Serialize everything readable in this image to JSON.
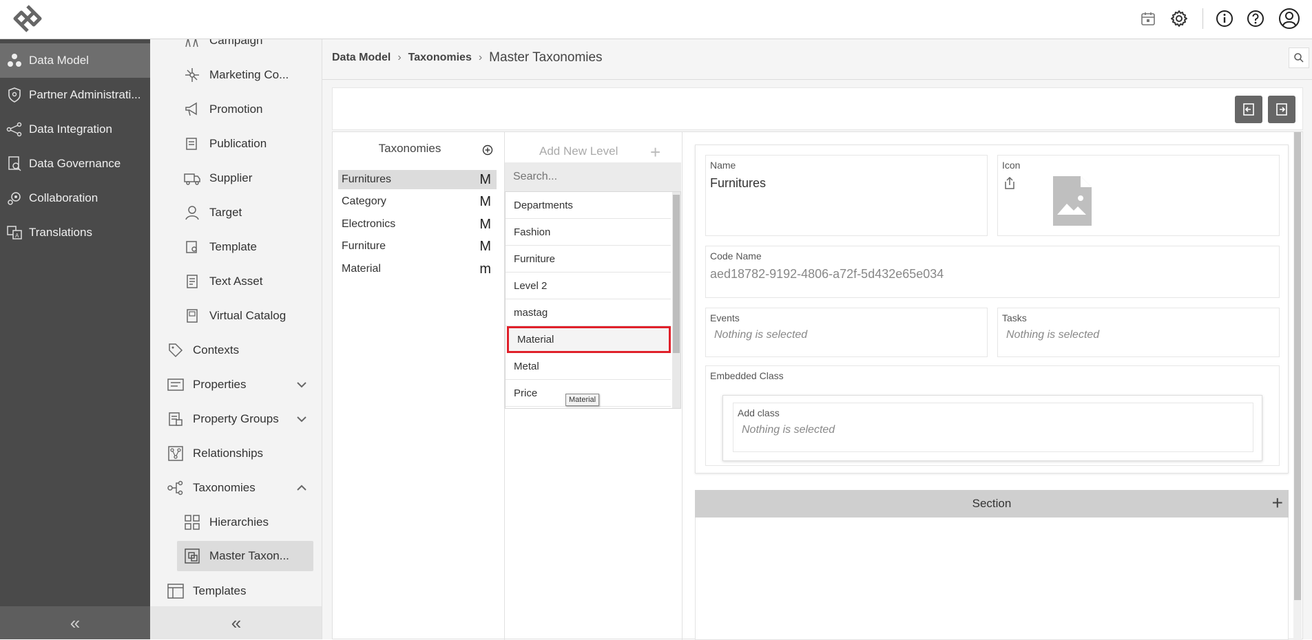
{
  "topbar": {
    "icons": [
      "calendar-icon",
      "gear-icon",
      "info-icon",
      "help-icon",
      "user-icon"
    ]
  },
  "leftnav": {
    "items": [
      {
        "label": "Data Model",
        "icon": "data-model-icon",
        "active": true
      },
      {
        "label": "Partner Administrati...",
        "icon": "shield-icon"
      },
      {
        "label": "Data Integration",
        "icon": "share-icon"
      },
      {
        "label": "Data Governance",
        "icon": "governance-icon"
      },
      {
        "label": "Collaboration",
        "icon": "collaboration-icon"
      },
      {
        "label": "Translations",
        "icon": "translate-icon"
      }
    ],
    "collapse": "«"
  },
  "subnav": {
    "items": [
      {
        "label": "Campaign"
      },
      {
        "label": "Marketing Co..."
      },
      {
        "label": "Promotion"
      },
      {
        "label": "Publication"
      },
      {
        "label": "Supplier"
      },
      {
        "label": "Target"
      },
      {
        "label": "Template"
      },
      {
        "label": "Text Asset"
      },
      {
        "label": "Virtual Catalog"
      },
      {
        "label": "Contexts"
      },
      {
        "label": "Properties"
      },
      {
        "label": "Property Groups"
      },
      {
        "label": "Relationships"
      },
      {
        "label": "Taxonomies"
      },
      {
        "label": "Hierarchies"
      },
      {
        "label": "Master Taxon..."
      },
      {
        "label": "Templates"
      }
    ],
    "collapse": "«"
  },
  "breadcrumb": {
    "items": [
      "Data Model",
      "Taxonomies"
    ],
    "current": "Master Taxonomies",
    "sep": "›"
  },
  "taxonomies": {
    "title": "Taxonomies",
    "items": [
      {
        "label": "Furnitures",
        "mark": "M",
        "selected": true
      },
      {
        "label": "Category",
        "mark": "M"
      },
      {
        "label": "Electronics",
        "mark": "M"
      },
      {
        "label": "Furniture",
        "mark": "M"
      },
      {
        "label": "Material",
        "mark": "m"
      }
    ]
  },
  "levels": {
    "add_label": "Add New Level",
    "plus": "+",
    "search_placeholder": "Search...",
    "items": [
      "Departments",
      "Fashion",
      "Furniture",
      "Level 2",
      "mastag",
      "Material",
      "Metal",
      "Price"
    ],
    "highlighted": "Material",
    "tooltip": "Material"
  },
  "detail": {
    "name_label": "Name",
    "name_value": "Furnitures",
    "icon_label": "Icon",
    "code_label": "Code Name",
    "code_value": "aed18782-9192-4806-a72f-5d432e65e034",
    "events_label": "Events",
    "events_value": "Nothing is selected",
    "tasks_label": "Tasks",
    "tasks_value": "Nothing is selected",
    "embedded_label": "Embedded Class",
    "addclass_label": "Add class",
    "addclass_value": "Nothing is selected",
    "section_label": "Section",
    "section_plus": "+"
  },
  "colors": {
    "nav_bg": "#4a4a4a",
    "highlight": "#e0202a"
  }
}
